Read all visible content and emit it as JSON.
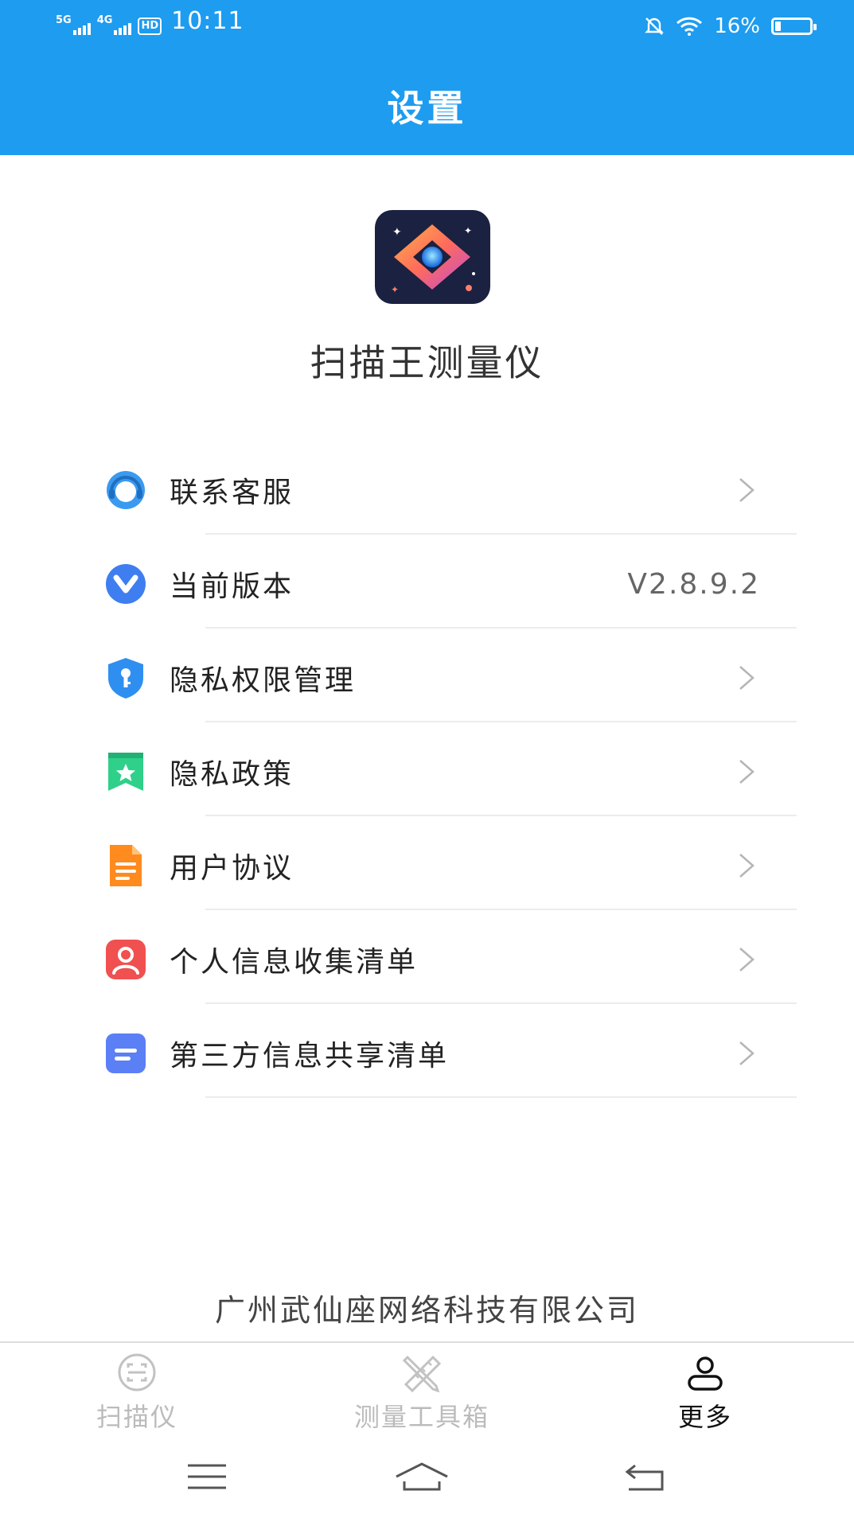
{
  "status_bar": {
    "signal_1": "5G",
    "signal_2": "4G",
    "hd_badge": "HD",
    "time": "10:11",
    "battery_text": "16%",
    "battery_level": 0.16,
    "icons": [
      "mute-icon",
      "wifi-icon",
      "battery-icon"
    ]
  },
  "header": {
    "title": "设置"
  },
  "app": {
    "name": "扫描王测量仪",
    "icon": "app-logo-icon"
  },
  "settings_list": [
    {
      "label": "联系客服",
      "icon": "customer-service-icon",
      "color": "#3a9af0"
    },
    {
      "label": "当前版本",
      "icon": "version-icon",
      "color": "#3f7ef0",
      "value": "V2.8.9.2"
    },
    {
      "label": "隐私权限管理",
      "icon": "shield-key-icon",
      "color": "#2f8ff0"
    },
    {
      "label": "隐私政策",
      "icon": "bookmark-star-icon",
      "color": "#2fd08a"
    },
    {
      "label": "用户协议",
      "icon": "document-icon",
      "color": "#ff8a1e"
    },
    {
      "label": "个人信息收集清单",
      "icon": "person-icon",
      "color": "#f05050"
    },
    {
      "label": "第三方信息共享清单",
      "icon": "note-icon",
      "color": "#5b7ff5"
    }
  ],
  "footer": {
    "company": "广州武仙座网络科技有限公司"
  },
  "tabs": [
    {
      "label": "扫描仪",
      "icon": "scan-icon",
      "active": false
    },
    {
      "label": "测量工具箱",
      "icon": "ruler-pencil-icon",
      "active": false
    },
    {
      "label": "更多",
      "icon": "user-icon",
      "active": true
    }
  ],
  "nav": [
    "menu-icon",
    "home-icon",
    "back-icon"
  ],
  "colors": {
    "accent": "#1e9cf0",
    "divider": "#ececec"
  }
}
